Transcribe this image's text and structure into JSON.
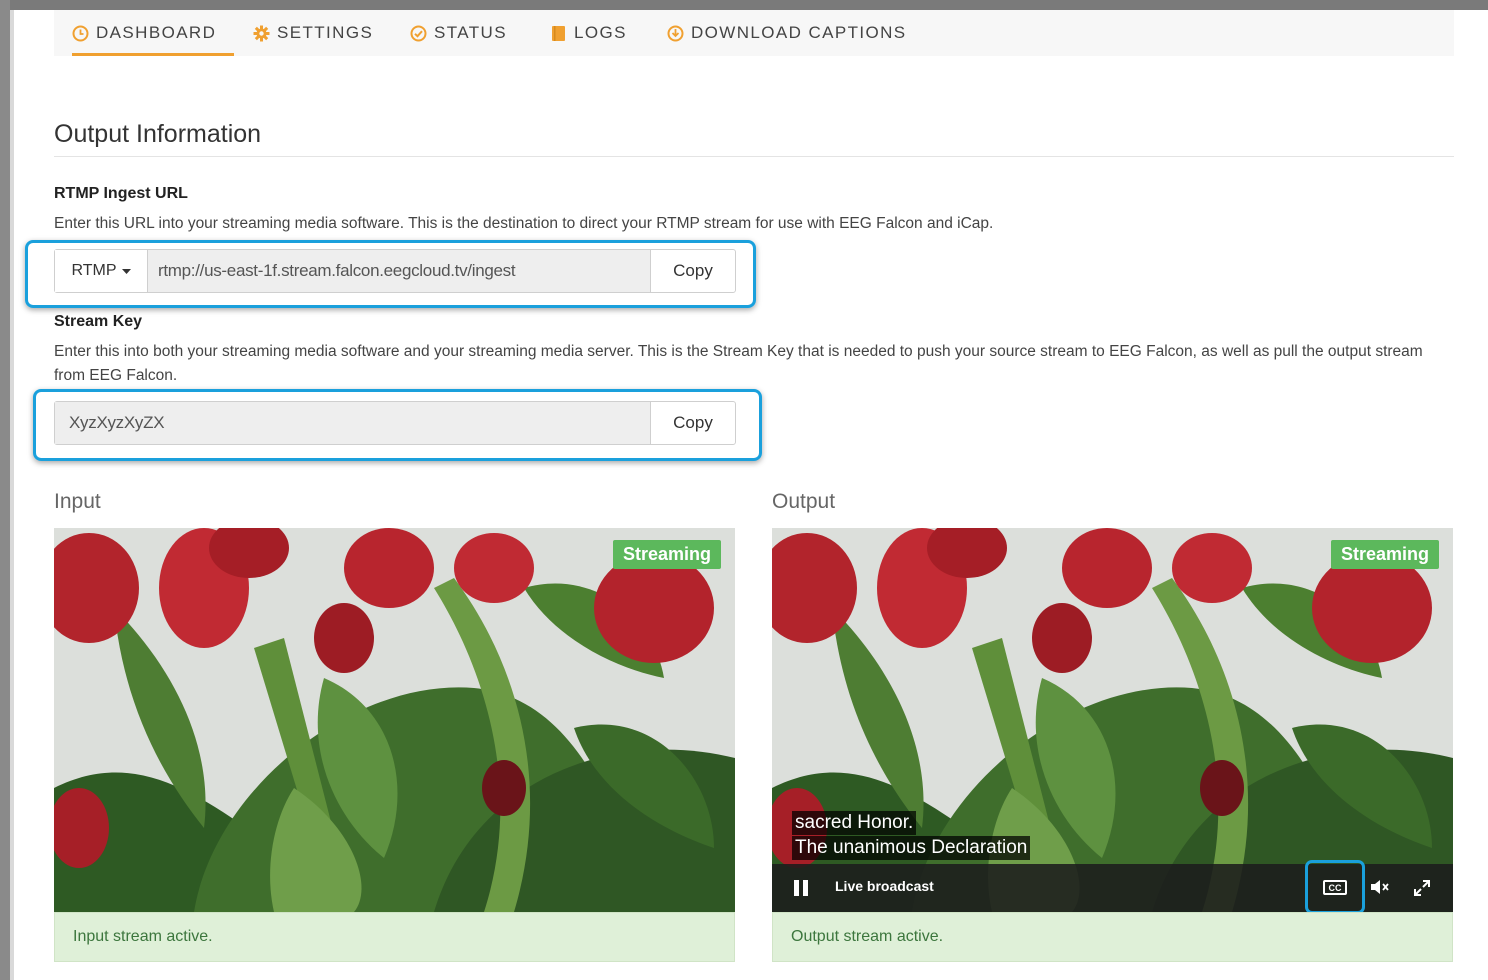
{
  "tabs": [
    {
      "label": "DASHBOARD",
      "icon": "clock-icon",
      "active": true
    },
    {
      "label": "SETTINGS",
      "icon": "gear-icon",
      "active": false
    },
    {
      "label": "STATUS",
      "icon": "check-circle-icon",
      "active": false
    },
    {
      "label": "LOGS",
      "icon": "book-icon",
      "active": false
    },
    {
      "label": "DOWNLOAD CAPTIONS",
      "icon": "download-circle-icon",
      "active": false
    }
  ],
  "colors": {
    "accent": "#f0a030",
    "highlight": "#1aa0dc",
    "streaming": "#5cb85c",
    "success_bg": "#dff0d8",
    "success_text": "#3c763d"
  },
  "output_info": {
    "title": "Output Information",
    "rtmp": {
      "label": "RTMP Ingest URL",
      "help": "Enter this URL into your streaming media software. This is the destination to direct your RTMP stream for use with EEG Falcon and iCap.",
      "protocol": "RTMP",
      "value": "rtmp://us-east-1f.stream.falcon.eegcloud.tv/ingest",
      "copy_label": "Copy"
    },
    "stream_key": {
      "label": "Stream Key",
      "help": "Enter this into both your streaming media software and your streaming media server. This is the Stream Key that is needed to push your source stream to EEG Falcon, as well as pull the output stream from EEG Falcon.",
      "value": "XyzXyzXyZX",
      "copy_label": "Copy"
    }
  },
  "input": {
    "title": "Input",
    "badge": "Streaming",
    "status": "Input stream active."
  },
  "output": {
    "title": "Output",
    "badge": "Streaming",
    "captions": [
      "sacred Honor.",
      "The unanimous Declaration"
    ],
    "live_label": "Live broadcast",
    "cc_label": "CC",
    "status": "Output stream active."
  }
}
